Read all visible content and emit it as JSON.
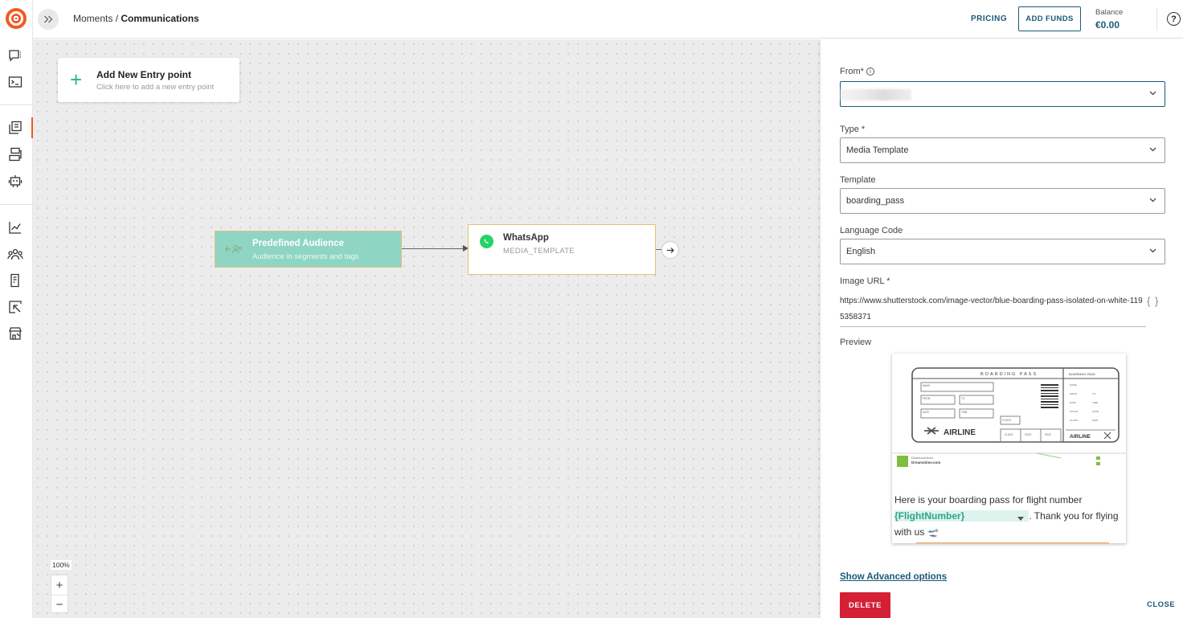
{
  "topbar": {
    "breadcrumb_parent": "Moments",
    "breadcrumb_sep": " / ",
    "breadcrumb_current": "Communications",
    "pricing_label": "PRICING",
    "add_funds_label": "ADD FUNDS",
    "balance_label": "Balance",
    "balance_value": "€0.00",
    "help_label": "?"
  },
  "canvas": {
    "entry_title": "Add New Entry point",
    "entry_subtitle": "Click here to add a new entry point",
    "audience_node": {
      "title": "Predefined Audience",
      "subtitle": "Audience in segments and tags"
    },
    "whatsapp_node": {
      "title": "WhatsApp",
      "subtitle": "MEDIA_TEMPLATE"
    },
    "zoom_level": "100%",
    "zoom_in": "+",
    "zoom_out": "−"
  },
  "panel": {
    "from_label": "From*",
    "from_value": "",
    "type_label": "Type *",
    "type_value": "Media Template",
    "template_label": "Template",
    "template_value": "boarding_pass",
    "language_label": "Language Code",
    "language_value": "English",
    "image_url_label": "Image URL *",
    "image_url_value": "https://www.shutterstock.com/image-vector/blue-boarding-pass-isolated-on-white-1195358371",
    "braces": "{ }",
    "preview_label": "Preview",
    "preview_image": {
      "header": "BOARDING PASS",
      "stub_header": "BOARDING PASS",
      "field_name": "NAME",
      "field_from": "FROM",
      "field_to": "TO",
      "field_date": "DATE",
      "field_time": "TIME",
      "field_flight": "FLIGHT",
      "field_class": "CLASS",
      "field_gate": "GATE",
      "field_seat": "SEAT",
      "stub_name": "NAME",
      "stub_from": "FROM",
      "stub_to": "TO",
      "stub_date": "DATE",
      "stub_time": "TIME",
      "stub_flight": "FLIGHT",
      "stub_gate": "GATE",
      "stub_class": "CLASS",
      "stub_seat": "SEAT",
      "airline": "AIRLINE",
      "stub_airline": "AIRLINE",
      "download_from": "Download from",
      "download_site": "Dreamstime.com"
    },
    "preview_msg_before": "Here is your boarding pass for flight number ",
    "preview_variable": "{FlightNumber}",
    "preview_msg_after": ". Thank you for flying with us ",
    "preview_emoji": "🛫",
    "advanced_label": "Show Advanced options",
    "delete_label": "DELETE",
    "close_label": "CLOSE"
  },
  "colors": {
    "brand_orange": "#f15a22",
    "primary_blue": "#1b5a7a",
    "teal": "#2ab38e",
    "danger": "#d32034"
  }
}
